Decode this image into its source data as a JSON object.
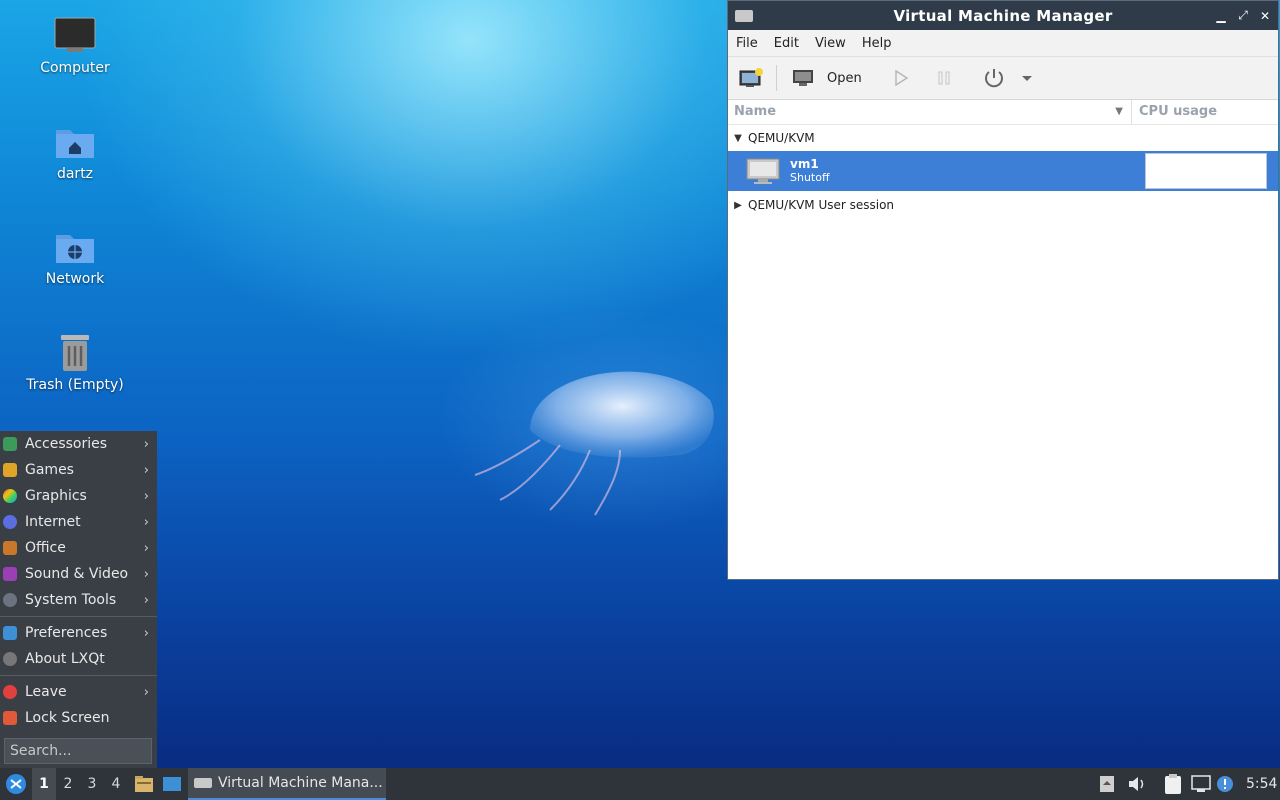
{
  "desktop": {
    "icons": [
      {
        "label": "Computer"
      },
      {
        "label": "dartz"
      },
      {
        "label": "Network"
      },
      {
        "label": "Trash (Empty)"
      }
    ]
  },
  "vmm": {
    "title": "Virtual Machine Manager",
    "menu": [
      "File",
      "Edit",
      "View",
      "Help"
    ],
    "toolbar": {
      "open_label": "Open"
    },
    "columns": {
      "name": "Name",
      "cpu": "CPU usage"
    },
    "groups": [
      {
        "label": "QEMU/KVM",
        "expanded": true
      },
      {
        "label": "QEMU/KVM User session",
        "expanded": false
      }
    ],
    "vms": [
      {
        "name": "vm1",
        "state": "Shutoff"
      }
    ],
    "colors": {
      "selection": "#3d7fd6",
      "titlebar": "#2f3b48"
    }
  },
  "startmenu": {
    "items": [
      {
        "label": "Accessories",
        "submenu": true
      },
      {
        "label": "Games",
        "submenu": true
      },
      {
        "label": "Graphics",
        "submenu": true
      },
      {
        "label": "Internet",
        "submenu": true
      },
      {
        "label": "Office",
        "submenu": true
      },
      {
        "label": "Sound & Video",
        "submenu": true
      },
      {
        "label": "System Tools",
        "submenu": true
      },
      {
        "label": "Preferences",
        "submenu": true
      },
      {
        "label": "About LXQt",
        "submenu": false
      },
      {
        "label": "Leave",
        "submenu": true
      },
      {
        "label": "Lock Screen",
        "submenu": false
      }
    ],
    "search_placeholder": "Search..."
  },
  "taskbar": {
    "workspaces": [
      "1",
      "2",
      "3",
      "4"
    ],
    "active_workspace": "1",
    "task_label": "Virtual Machine Mana...",
    "clock": "5:54"
  }
}
